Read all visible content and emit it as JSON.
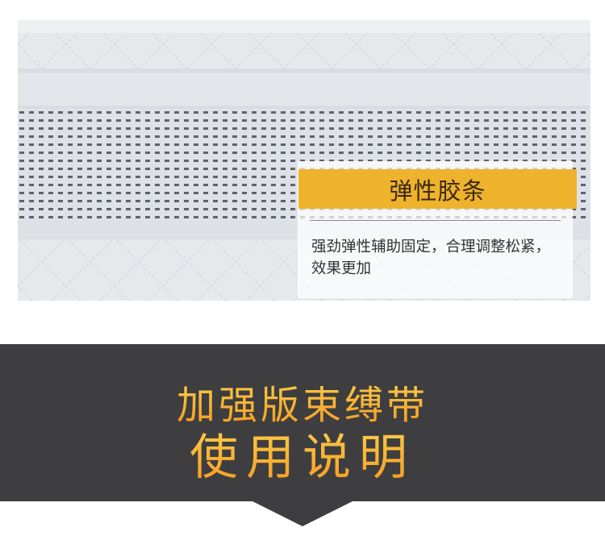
{
  "callout": {
    "title": "弹性胶条",
    "body": "强劲弹性辅助固定，合理调整松紧，效果更加"
  },
  "banner": {
    "line1": "加强版束缚带",
    "line2": "使用说明"
  },
  "colors": {
    "accent": "#efb22c",
    "banner_bg": "#3e3e40",
    "headline": "#f5a623"
  },
  "icons": {
    "pointer": "down-triangle-icon"
  }
}
